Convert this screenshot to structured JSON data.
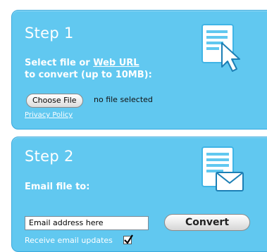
{
  "step1": {
    "title": "Step 1",
    "line1_prefix": "Select file or ",
    "line1_link": "Web URL",
    "line2": "to convert (up to 10MB):",
    "choose_file_label": "Choose File",
    "no_file_text": "no file selected",
    "privacy_link": "Privacy Policy",
    "icon": "file-select-cursor-icon"
  },
  "step2": {
    "title": "Step 2",
    "email_label": "Email file to:",
    "email_placeholder": "Email address here",
    "convert_label": "Convert",
    "receive_updates_label": "Receive email updates",
    "receive_updates_checked": true,
    "icon": "document-envelope-icon"
  },
  "colors": {
    "panel_bg": "#61c8f0",
    "panel_border": "#3aa9dc",
    "text": "#ffffff"
  }
}
